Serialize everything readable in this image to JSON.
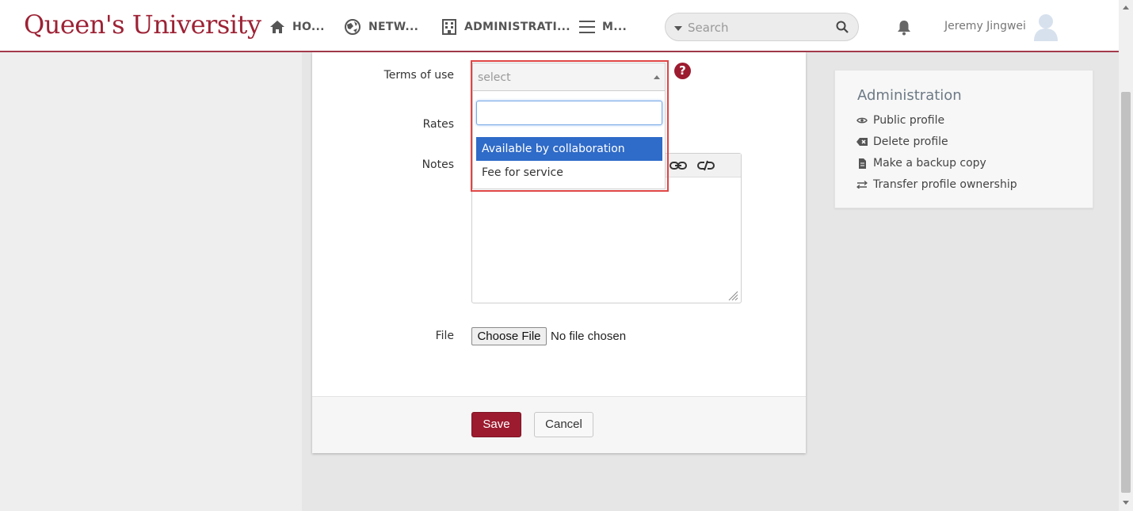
{
  "header": {
    "logo": "Queen's University",
    "nav": [
      {
        "label": "HO...",
        "icon": "home-icon"
      },
      {
        "label": "NETW...",
        "icon": "network-icon"
      },
      {
        "label": "ADMINISTRATI...",
        "icon": "building-icon"
      },
      {
        "label": "M...",
        "icon": "menu-icon"
      }
    ],
    "search": {
      "placeholder": "Search"
    },
    "user": {
      "name": "Jeremy Jingwei"
    }
  },
  "form": {
    "terms_label": "Terms of use",
    "terms_select": {
      "value": "select",
      "search_value": "",
      "options": [
        "Available by collaboration",
        "Fee for service"
      ],
      "highlighted": "Available by collaboration"
    },
    "help_glyph": "?",
    "rates_label": "Rates",
    "notes_label": "Notes",
    "file_label": "File",
    "file_button": "Choose File",
    "file_status": "No file chosen",
    "save_label": "Save",
    "cancel_label": "Cancel"
  },
  "sidebar": {
    "title": "Administration",
    "items": [
      {
        "label": "Public profile",
        "icon": "eye-icon"
      },
      {
        "label": "Delete profile",
        "icon": "delete-icon"
      },
      {
        "label": "Make a backup copy",
        "icon": "document-icon"
      },
      {
        "label": "Transfer profile ownership",
        "icon": "transfer-icon"
      }
    ]
  },
  "colors": {
    "brand": "#9d2235",
    "selected_option": "#2f6bc8",
    "highlight_border": "#e04545"
  }
}
